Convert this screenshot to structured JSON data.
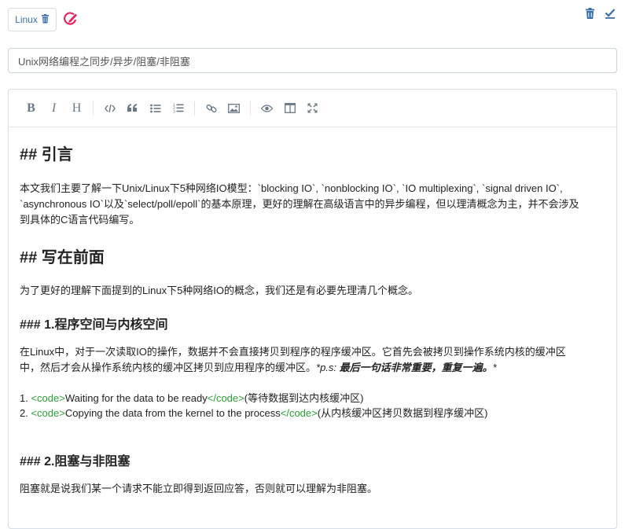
{
  "header": {
    "tag_label": "Linux",
    "trash_icon": "trash-icon",
    "edit_tag_icon": "edit-tag-icon",
    "delete_icon": "trash-icon",
    "save_icon": "check-icon"
  },
  "title_input": {
    "value": "Unix网络编程之同步/异步/阻塞/非阻塞"
  },
  "toolbar": {
    "bold": "B",
    "italic": "I",
    "heading": "H"
  },
  "content": {
    "h_intro": "## 引言",
    "p_intro_1": "本文我们主要了解一下Unix/Linux下5种网络IO模型：`blocking IO`, `nonblocking IO`, `IO multiplexing`, `signal driven IO`,",
    "p_intro_2": "`asynchronous IO`以及`select/poll/epoll`的基本原理，更好的理解在高级语言中的异步编程，但以理清概念为主，并不会涉及",
    "p_intro_3": "到具体的C语言代码编写。",
    "h_front": "## 写在前面",
    "p_front": "为了更好的理解下面提到的Linux下5种网络IO的概念，我们还是有必要先理清几个概念。",
    "h3_space": "### 1.程序空间与内核空间",
    "p_space_1": "在Linux中，对于一次读取IO的操作，数据并不会直接拷贝到程序的程序缓冲区。它首先会被拷贝到操作系统内核的缓冲区",
    "p_space_2a": "中，然后才会从操作系统内核的缓冲区拷贝到应用程序的缓冲区。",
    "p_space_2b": "*p.s: ",
    "p_space_2c": "最后一句话非常重要，重复一遍。",
    "p_space_2d": "*",
    "li1_num": "1. ",
    "li1_open": "<code>",
    "li1_text": "Waiting for the data to be ready",
    "li1_close": "</code>",
    "li1_tail": "(等待数据到达内核缓冲区)",
    "li2_num": "2. ",
    "li2_open": "<code>",
    "li2_text": "Copying the data from the kernel to the process",
    "li2_close": "</code>",
    "li2_tail": "(从内核缓冲区拷贝数据到程序缓冲区)",
    "h3_block": "### 2.阻塞与非阻塞",
    "p_block": "阻塞就是说我们某一个请求不能立即得到返回应答，否则就可以理解为非阻塞。"
  }
}
